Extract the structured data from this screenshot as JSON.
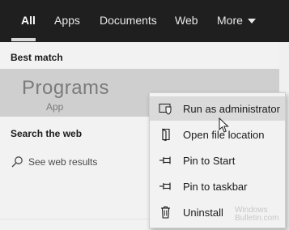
{
  "tabs": {
    "all": "All",
    "apps": "Apps",
    "documents": "Documents",
    "web": "Web",
    "more": "More"
  },
  "left": {
    "best_match_title": "Best match",
    "app_name": "Programs",
    "app_type": "App",
    "search_web_title": "Search the web",
    "see_web_results": "See web results"
  },
  "context_menu": {
    "items": [
      {
        "label": "Run as administrator",
        "icon": "shield-icon"
      },
      {
        "label": "Open file location",
        "icon": "folder-icon"
      },
      {
        "label": "Pin to Start",
        "icon": "pin-icon"
      },
      {
        "label": "Pin to taskbar",
        "icon": "pin-icon"
      },
      {
        "label": "Uninstall",
        "icon": "trash-icon"
      }
    ]
  },
  "watermark": {
    "line1": "Windows",
    "line2": "Bulletin.com"
  },
  "colors": {
    "tabbar_bg": "#1f1f1f",
    "panel_bg": "#f2f2f2",
    "selected_row_bg": "#cfcfcf",
    "menu_hover_bg": "#dadada"
  }
}
